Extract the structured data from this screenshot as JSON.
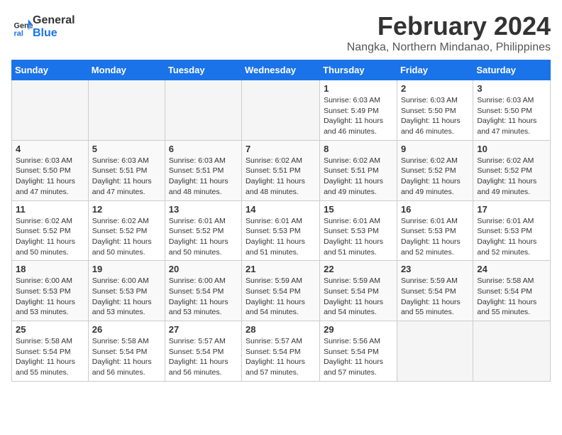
{
  "logo": {
    "line1": "General",
    "line2": "Blue"
  },
  "title": "February 2024",
  "subtitle": "Nangka, Northern Mindanao, Philippines",
  "days_of_week": [
    "Sunday",
    "Monday",
    "Tuesday",
    "Wednesday",
    "Thursday",
    "Friday",
    "Saturday"
  ],
  "weeks": [
    [
      {
        "day": "",
        "info": ""
      },
      {
        "day": "",
        "info": ""
      },
      {
        "day": "",
        "info": ""
      },
      {
        "day": "",
        "info": ""
      },
      {
        "day": "1",
        "info": "Sunrise: 6:03 AM\nSunset: 5:49 PM\nDaylight: 11 hours and 46 minutes."
      },
      {
        "day": "2",
        "info": "Sunrise: 6:03 AM\nSunset: 5:50 PM\nDaylight: 11 hours and 46 minutes."
      },
      {
        "day": "3",
        "info": "Sunrise: 6:03 AM\nSunset: 5:50 PM\nDaylight: 11 hours and 47 minutes."
      }
    ],
    [
      {
        "day": "4",
        "info": "Sunrise: 6:03 AM\nSunset: 5:50 PM\nDaylight: 11 hours and 47 minutes."
      },
      {
        "day": "5",
        "info": "Sunrise: 6:03 AM\nSunset: 5:51 PM\nDaylight: 11 hours and 47 minutes."
      },
      {
        "day": "6",
        "info": "Sunrise: 6:03 AM\nSunset: 5:51 PM\nDaylight: 11 hours and 48 minutes."
      },
      {
        "day": "7",
        "info": "Sunrise: 6:02 AM\nSunset: 5:51 PM\nDaylight: 11 hours and 48 minutes."
      },
      {
        "day": "8",
        "info": "Sunrise: 6:02 AM\nSunset: 5:51 PM\nDaylight: 11 hours and 49 minutes."
      },
      {
        "day": "9",
        "info": "Sunrise: 6:02 AM\nSunset: 5:52 PM\nDaylight: 11 hours and 49 minutes."
      },
      {
        "day": "10",
        "info": "Sunrise: 6:02 AM\nSunset: 5:52 PM\nDaylight: 11 hours and 49 minutes."
      }
    ],
    [
      {
        "day": "11",
        "info": "Sunrise: 6:02 AM\nSunset: 5:52 PM\nDaylight: 11 hours and 50 minutes."
      },
      {
        "day": "12",
        "info": "Sunrise: 6:02 AM\nSunset: 5:52 PM\nDaylight: 11 hours and 50 minutes."
      },
      {
        "day": "13",
        "info": "Sunrise: 6:01 AM\nSunset: 5:52 PM\nDaylight: 11 hours and 50 minutes."
      },
      {
        "day": "14",
        "info": "Sunrise: 6:01 AM\nSunset: 5:53 PM\nDaylight: 11 hours and 51 minutes."
      },
      {
        "day": "15",
        "info": "Sunrise: 6:01 AM\nSunset: 5:53 PM\nDaylight: 11 hours and 51 minutes."
      },
      {
        "day": "16",
        "info": "Sunrise: 6:01 AM\nSunset: 5:53 PM\nDaylight: 11 hours and 52 minutes."
      },
      {
        "day": "17",
        "info": "Sunrise: 6:01 AM\nSunset: 5:53 PM\nDaylight: 11 hours and 52 minutes."
      }
    ],
    [
      {
        "day": "18",
        "info": "Sunrise: 6:00 AM\nSunset: 5:53 PM\nDaylight: 11 hours and 53 minutes."
      },
      {
        "day": "19",
        "info": "Sunrise: 6:00 AM\nSunset: 5:53 PM\nDaylight: 11 hours and 53 minutes."
      },
      {
        "day": "20",
        "info": "Sunrise: 6:00 AM\nSunset: 5:54 PM\nDaylight: 11 hours and 53 minutes."
      },
      {
        "day": "21",
        "info": "Sunrise: 5:59 AM\nSunset: 5:54 PM\nDaylight: 11 hours and 54 minutes."
      },
      {
        "day": "22",
        "info": "Sunrise: 5:59 AM\nSunset: 5:54 PM\nDaylight: 11 hours and 54 minutes."
      },
      {
        "day": "23",
        "info": "Sunrise: 5:59 AM\nSunset: 5:54 PM\nDaylight: 11 hours and 55 minutes."
      },
      {
        "day": "24",
        "info": "Sunrise: 5:58 AM\nSunset: 5:54 PM\nDaylight: 11 hours and 55 minutes."
      }
    ],
    [
      {
        "day": "25",
        "info": "Sunrise: 5:58 AM\nSunset: 5:54 PM\nDaylight: 11 hours and 55 minutes."
      },
      {
        "day": "26",
        "info": "Sunrise: 5:58 AM\nSunset: 5:54 PM\nDaylight: 11 hours and 56 minutes."
      },
      {
        "day": "27",
        "info": "Sunrise: 5:57 AM\nSunset: 5:54 PM\nDaylight: 11 hours and 56 minutes."
      },
      {
        "day": "28",
        "info": "Sunrise: 5:57 AM\nSunset: 5:54 PM\nDaylight: 11 hours and 57 minutes."
      },
      {
        "day": "29",
        "info": "Sunrise: 5:56 AM\nSunset: 5:54 PM\nDaylight: 11 hours and 57 minutes."
      },
      {
        "day": "",
        "info": ""
      },
      {
        "day": "",
        "info": ""
      }
    ]
  ]
}
